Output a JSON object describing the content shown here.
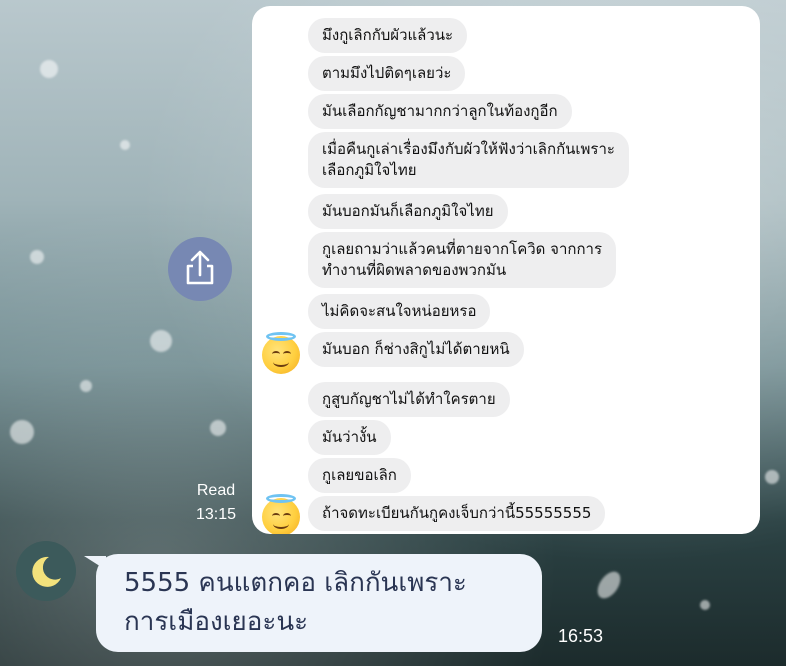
{
  "screenshot_chat": {
    "messages": [
      {
        "text": "มึงกูเลิกกับผัวแล้วนะ"
      },
      {
        "text": "ตามมึงไปติดๆเลยว่ะ"
      },
      {
        "text": "มันเลือกกัญชามากกว่าลูกในท้องกูอีก"
      },
      {
        "text_line1": "เมื่อคืนกูเล่าเรื่องมึงกับผัวให้ฟังว่าเลิกกันเพราะ",
        "text_line2": "เลือกภูมิใจไทย"
      },
      {
        "text": "มันบอกมันก็เลือกภูมิใจไทย"
      },
      {
        "text_line1": "กูเลยถามว่าแล้วคนที่ตายจากโควิด จากการ",
        "text_line2": "ทำงานที่ผิดพลาดของพวกมัน"
      },
      {
        "text": "ไม่คิดจะสนใจหน่อยหรอ"
      },
      {
        "text": "มันบอก ก็ช่างสิกูไม่ได้ตายหนิ"
      },
      {
        "text": "กูสูบกัญชาไม่ได้ทำใครตาย"
      },
      {
        "text": "มันว่างั้น"
      },
      {
        "text": "กูเลยขอเลิก"
      },
      {
        "text": "ถ้าจดทะเบียนกันกูคงเจ็บกว่านี้55555555"
      }
    ],
    "avatar_icon": "smiling-face-with-halo-emoji"
  },
  "status": {
    "read_label": "Read",
    "read_time": "13:15"
  },
  "main_message": {
    "line1": "5555 คนแตกคอ เลิกกันเพราะ",
    "line2": "การเมืองเยอะนะ",
    "time": "16:53",
    "avatar_icon": "crescent-moon-icon"
  },
  "share_button": {
    "icon": "share-icon"
  },
  "colors": {
    "share_button_bg": "#7788b3",
    "bubble_bg": "#eef3fa",
    "bubble_text": "#2a3553",
    "screenshot_bubble_bg": "#eeeeef"
  }
}
